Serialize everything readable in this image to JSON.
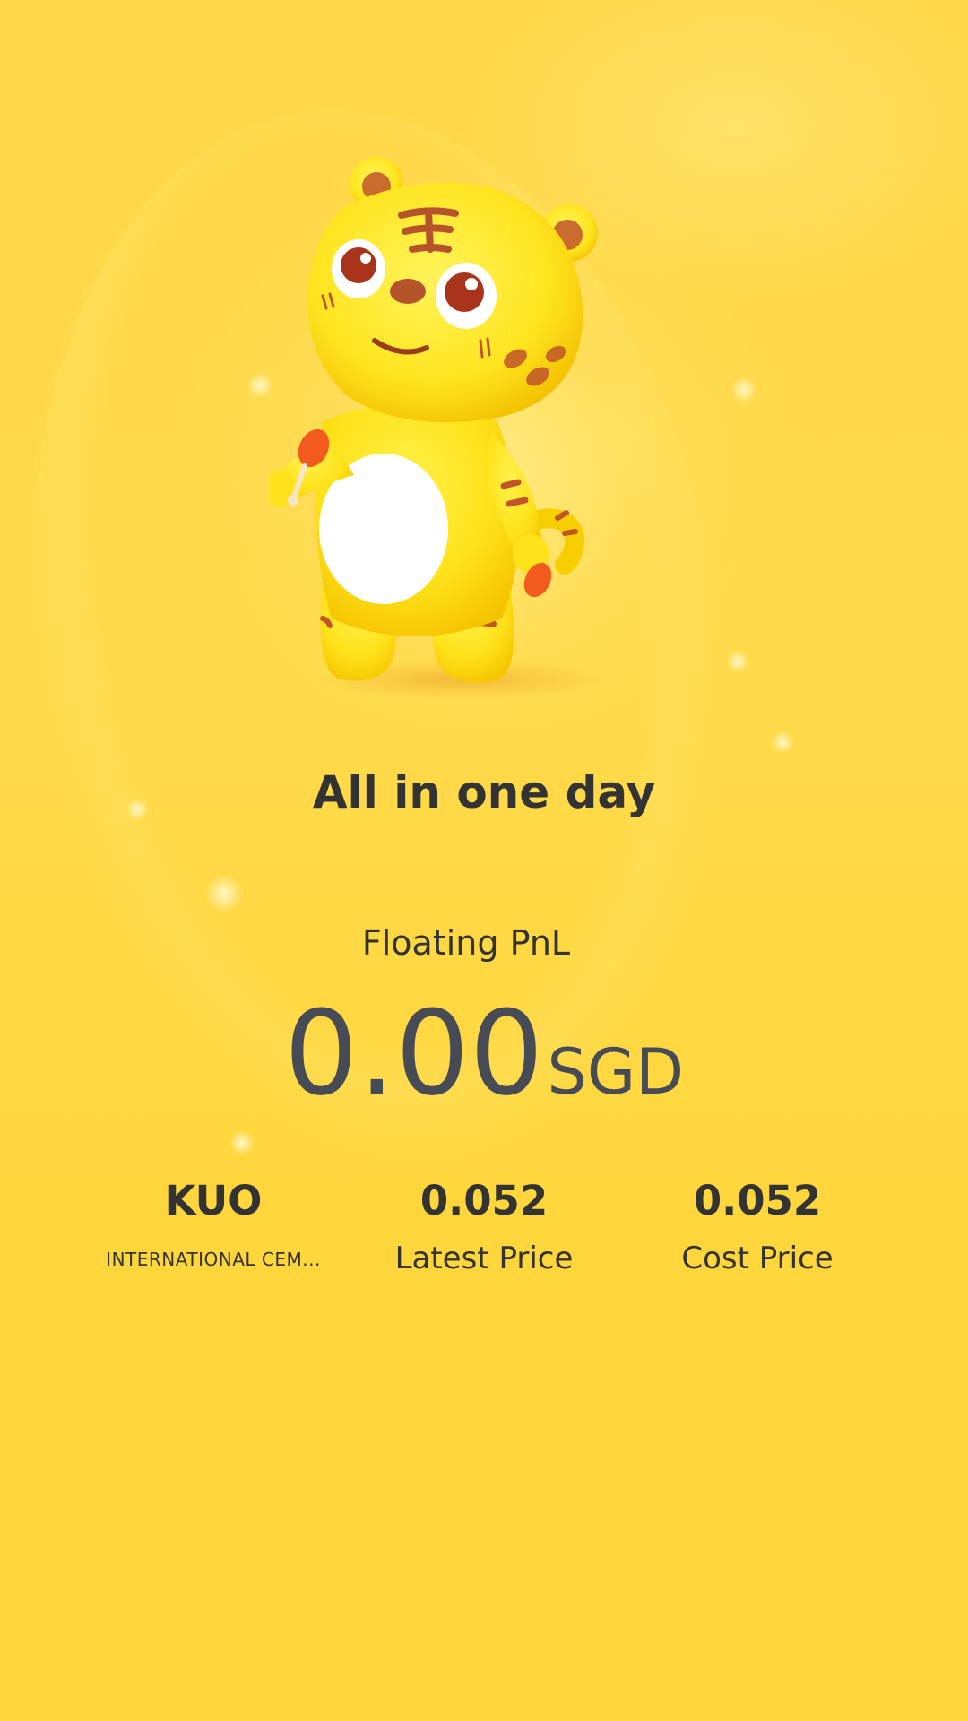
{
  "headline": "All in one day",
  "pnl": {
    "label": "Floating PnL",
    "value": "0.00",
    "currency": "SGD"
  },
  "stats": [
    {
      "value": "KUO",
      "label": "INTERNATIONAL CEM..."
    },
    {
      "value": "0.052",
      "label": "Latest Price"
    },
    {
      "value": "0.052",
      "label": "Cost Price"
    }
  ],
  "colors": {
    "background": "#ffd84a",
    "text_dark": "#333333",
    "pnl_value": "#474b56",
    "mascot_body": "#ffe21a",
    "mascot_stripes": "#c0552a"
  }
}
